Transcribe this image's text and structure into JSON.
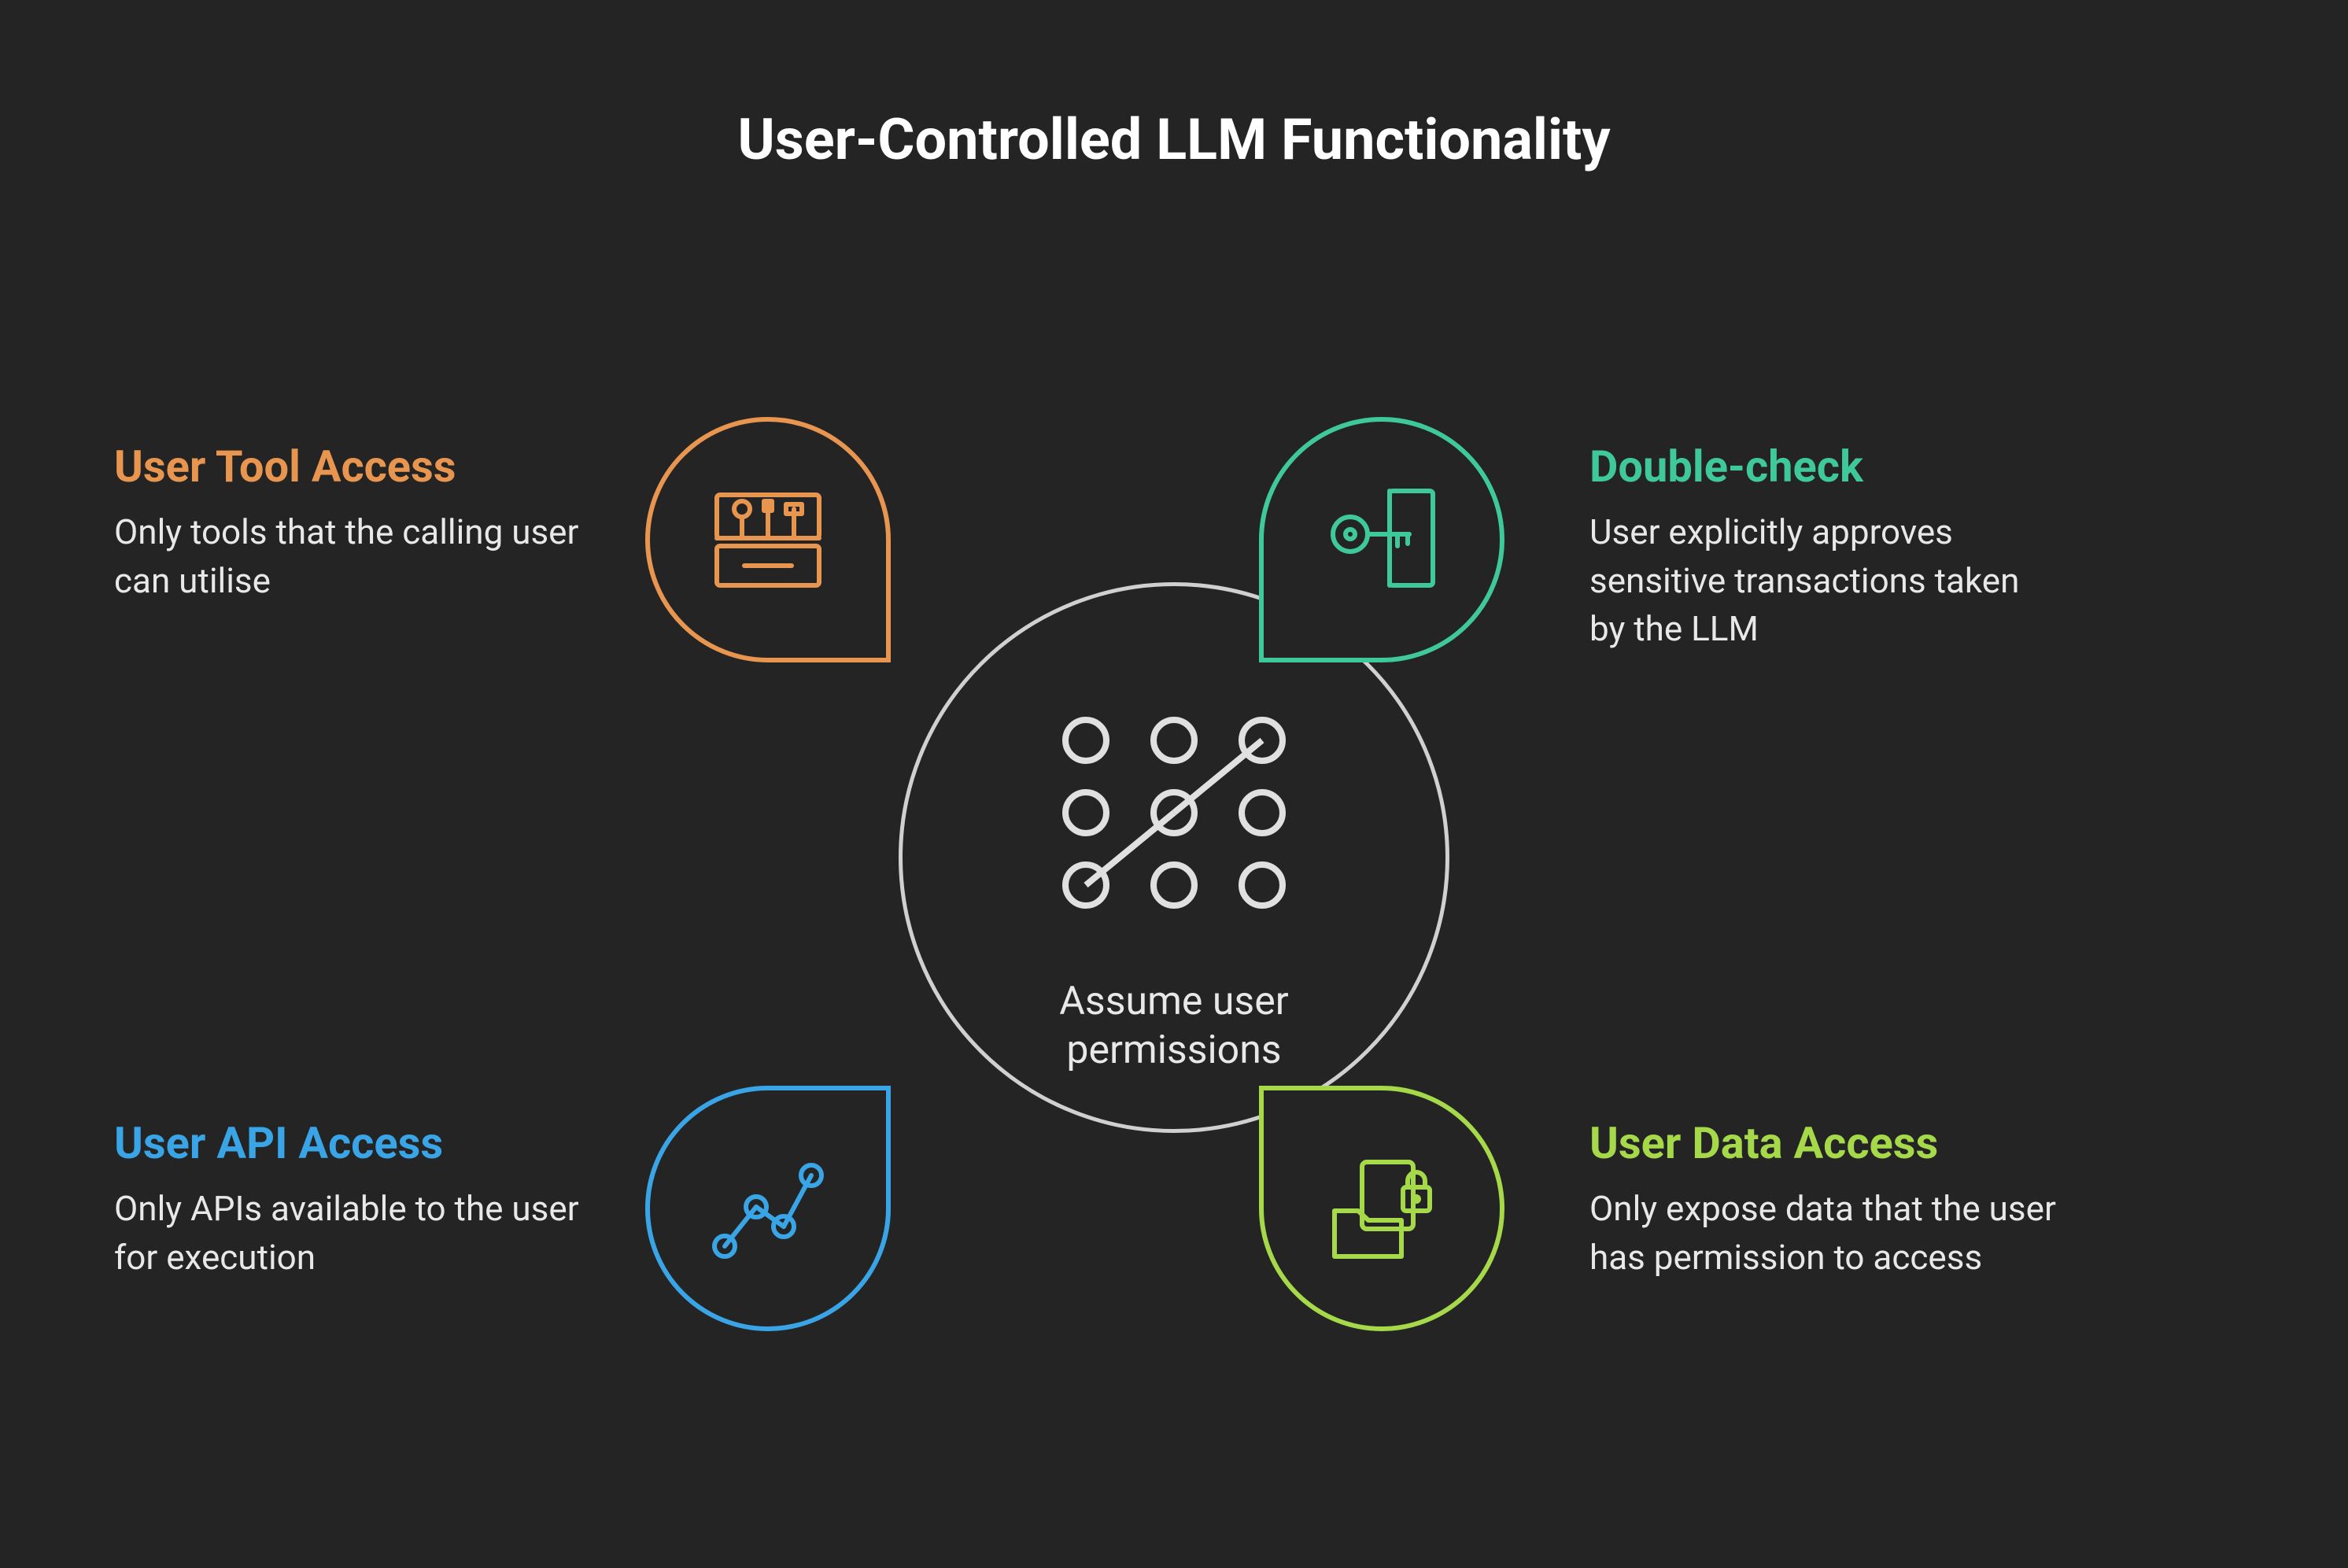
{
  "title": "User-Controlled LLM Functionality",
  "center": {
    "caption_line1": "Assume user",
    "caption_line2": "permissions"
  },
  "nodes": {
    "tool": {
      "title": "User Tool Access",
      "desc": "Only tools that the calling user can utilise",
      "color": "#e8964f"
    },
    "check": {
      "title": "Double-check",
      "desc": "User explicitly approves sensitive transactions taken by the LLM",
      "color": "#3fc99b"
    },
    "api": {
      "title": "User API Access",
      "desc": "Only APIs available to the user for execution",
      "color": "#3aa5e6"
    },
    "data": {
      "title": "User Data Access",
      "desc": "Only expose data that the user has permission to access",
      "color": "#a6d94a"
    }
  }
}
